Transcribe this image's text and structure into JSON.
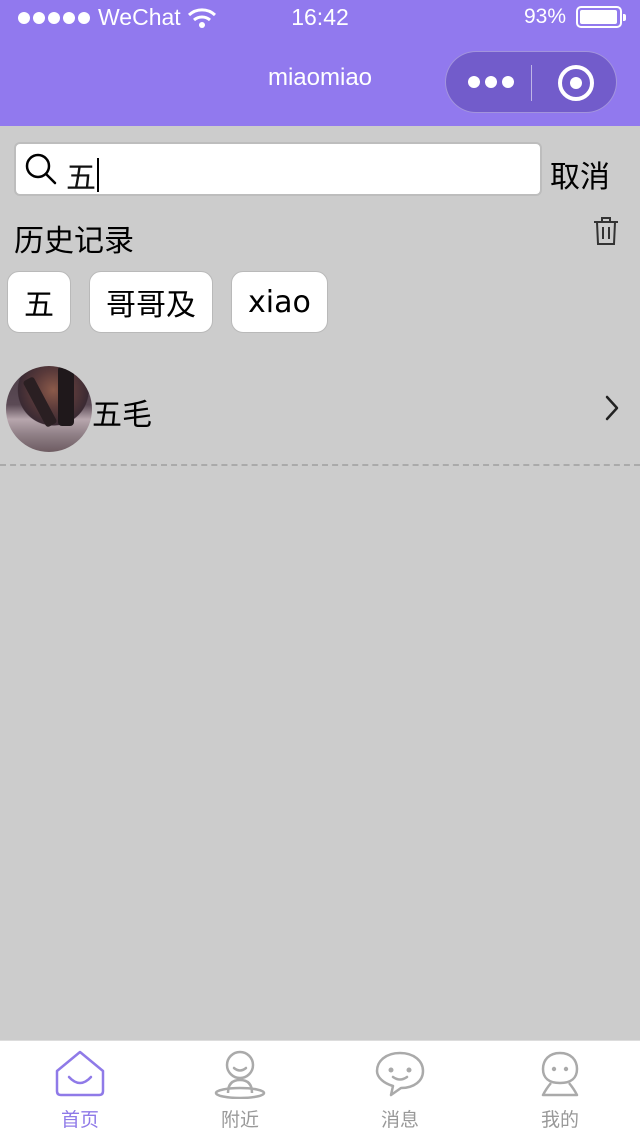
{
  "status_bar": {
    "carrier": "WeChat",
    "time": "16:42",
    "battery": "93%"
  },
  "nav": {
    "title": "miaomiao"
  },
  "search": {
    "value": "五",
    "cancel_label": "取消"
  },
  "history": {
    "title": "历史记录",
    "items": [
      "五",
      "哥哥及",
      "xiao"
    ]
  },
  "results": [
    {
      "name": "五毛"
    }
  ],
  "tabbar": {
    "items": [
      {
        "label": "首页",
        "active": true
      },
      {
        "label": "附近"
      },
      {
        "label": "消息"
      },
      {
        "label": "我的"
      }
    ]
  },
  "colors": {
    "primary": "#9179ee",
    "background": "#cccccc",
    "tab_active": "#8f7ae8",
    "tab_inactive": "#999999"
  }
}
